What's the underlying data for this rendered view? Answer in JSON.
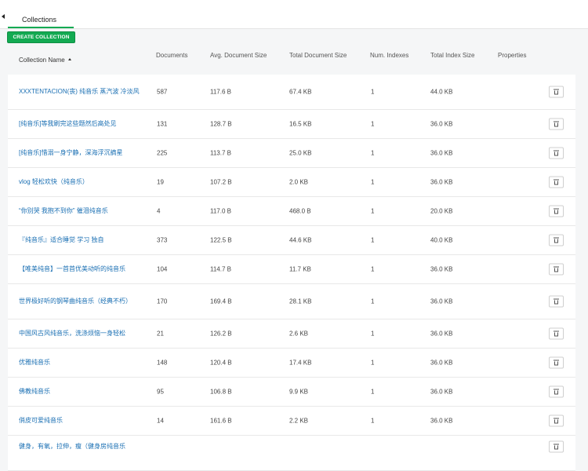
{
  "tabs": [
    {
      "label": "Collections"
    }
  ],
  "toolbar": {
    "create_label": "CREATE COLLECTION"
  },
  "columns": {
    "name": "Collection Name",
    "documents": "Documents",
    "avg_size": "Avg. Document Size",
    "total_size": "Total Document Size",
    "num_indexes": "Num. Indexes",
    "index_size": "Total Index Size",
    "properties": "Properties"
  },
  "rows": [
    {
      "name": "XXXTENTACION(丧) 纯音乐 蒸汽波 冷淡风",
      "documents": "587",
      "avg_size": "117.6 B",
      "total_size": "67.4 KB",
      "num_indexes": "1",
      "index_size": "44.0 KB"
    },
    {
      "name": "[纯音乐]等我刷完这些题然后高处见",
      "documents": "131",
      "avg_size": "128.7 B",
      "total_size": "16.5 KB",
      "num_indexes": "1",
      "index_size": "36.0 KB"
    },
    {
      "name": "[纯音乐]惜溺一身宁静，深海浮沉摘星",
      "documents": "225",
      "avg_size": "113.7 B",
      "total_size": "25.0 KB",
      "num_indexes": "1",
      "index_size": "36.0 KB"
    },
    {
      "name": "vlog 轻松欢快（纯音乐）",
      "documents": "19",
      "avg_size": "107.2 B",
      "total_size": "2.0 KB",
      "num_indexes": "1",
      "index_size": "36.0 KB"
    },
    {
      "name": "“你别哭 我抱不到你” 催泪纯音乐",
      "documents": "4",
      "avg_size": "117.0 B",
      "total_size": "468.0 B",
      "num_indexes": "1",
      "index_size": "20.0 KB"
    },
    {
      "name": "『纯音乐』适合睡觉 学习 独自",
      "documents": "373",
      "avg_size": "122.5 B",
      "total_size": "44.6 KB",
      "num_indexes": "1",
      "index_size": "40.0 KB"
    },
    {
      "name": "【唯美纯音】一首首优美动听的纯音乐",
      "documents": "104",
      "avg_size": "114.7 B",
      "total_size": "11.7 KB",
      "num_indexes": "1",
      "index_size": "36.0 KB"
    },
    {
      "name": "世界极好听的钢琴曲纯音乐（经典不朽）",
      "documents": "170",
      "avg_size": "169.4 B",
      "total_size": "28.1 KB",
      "num_indexes": "1",
      "index_size": "36.0 KB"
    },
    {
      "name": "中国风古风纯音乐，洗涤烦恼一身轻松",
      "documents": "21",
      "avg_size": "126.2 B",
      "total_size": "2.6 KB",
      "num_indexes": "1",
      "index_size": "36.0 KB"
    },
    {
      "name": "优雅纯音乐",
      "documents": "148",
      "avg_size": "120.4 B",
      "total_size": "17.4 KB",
      "num_indexes": "1",
      "index_size": "36.0 KB"
    },
    {
      "name": "佛教纯音乐",
      "documents": "95",
      "avg_size": "106.8 B",
      "total_size": "9.9 KB",
      "num_indexes": "1",
      "index_size": "36.0 KB"
    },
    {
      "name": "俏皮可爱纯音乐",
      "documents": "14",
      "avg_size": "161.6 B",
      "total_size": "2.2 KB",
      "num_indexes": "1",
      "index_size": "36.0 KB"
    },
    {
      "name": "健身，有氧，拉伸，瘦（健身房纯音乐",
      "documents": "",
      "avg_size": "",
      "total_size": "",
      "num_indexes": "",
      "index_size": ""
    }
  ]
}
